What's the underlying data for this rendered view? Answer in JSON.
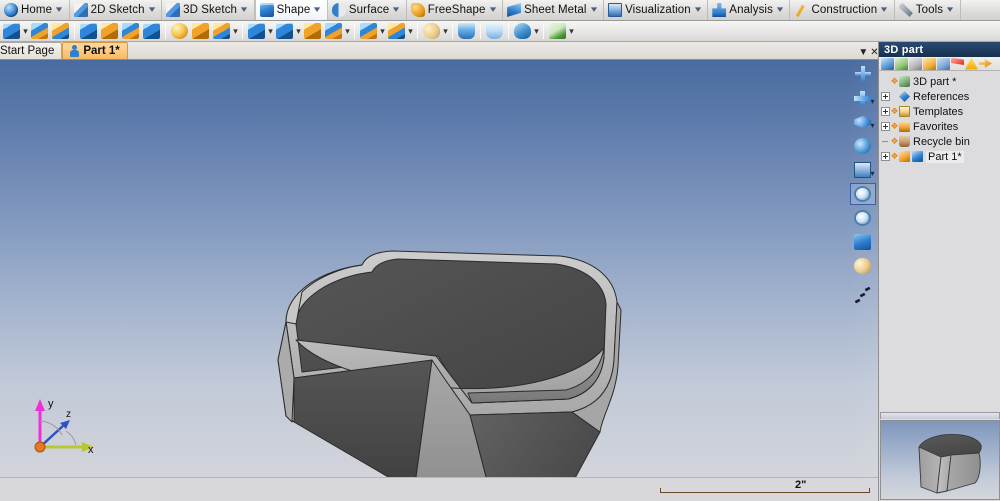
{
  "menubar": {
    "tabs": [
      {
        "label": "Home",
        "icon": "home-icon",
        "caret": true,
        "active": false
      },
      {
        "label": "2D Sketch",
        "icon": "pencil-icon",
        "caret": true,
        "active": false
      },
      {
        "label": "3D Sketch",
        "icon": "pencil-icon",
        "caret": true,
        "active": false
      },
      {
        "label": "Shape",
        "icon": "cube-icon",
        "caret": true,
        "active": true
      },
      {
        "label": "Surface",
        "icon": "surface-icon",
        "caret": true,
        "active": false
      },
      {
        "label": "FreeShape",
        "icon": "freeshape-icon",
        "caret": true,
        "active": false
      },
      {
        "label": "Sheet Metal",
        "icon": "sheetmetal-icon",
        "caret": true,
        "active": false
      },
      {
        "label": "Visualization",
        "icon": "monitor-icon",
        "caret": true,
        "active": false
      },
      {
        "label": "Analysis",
        "icon": "analysis-icon",
        "caret": true,
        "active": false
      },
      {
        "label": "Construction",
        "icon": "construction-icon",
        "caret": true,
        "active": false
      },
      {
        "label": "Tools",
        "icon": "wrench-icon",
        "caret": true,
        "active": false
      }
    ]
  },
  "toolbar": {
    "groups": [
      {
        "buttons": [
          {
            "icon": "extrude-icon",
            "style": "g-blue",
            "dropdown": true
          },
          {
            "icon": "revolve-icon",
            "style": "g-blueor",
            "dropdown": false
          },
          {
            "icon": "sweep-icon",
            "style": "g-orblue",
            "dropdown": false
          }
        ]
      },
      {
        "buttons": [
          {
            "icon": "box-icon",
            "style": "g-blue",
            "dropdown": false
          },
          {
            "icon": "cylinder-icon",
            "style": "g-orange",
            "dropdown": false
          },
          {
            "icon": "loft-icon",
            "style": "g-blueor",
            "dropdown": false
          },
          {
            "icon": "rib-icon",
            "style": "g-blue",
            "dropdown": false
          }
        ]
      },
      {
        "buttons": [
          {
            "icon": "sphere-icon",
            "style": "g-sphere",
            "dropdown": false
          },
          {
            "icon": "cube-solid-icon",
            "style": "g-orange",
            "dropdown": false
          },
          {
            "icon": "cone-icon",
            "style": "g-orblue",
            "dropdown": true
          }
        ]
      },
      {
        "buttons": [
          {
            "icon": "fillet-icon",
            "style": "g-blue",
            "dropdown": true
          },
          {
            "icon": "chamfer-icon",
            "style": "g-blue",
            "dropdown": true
          },
          {
            "icon": "draft-icon",
            "style": "g-orange",
            "dropdown": false
          },
          {
            "icon": "shell-icon",
            "style": "g-blueor",
            "dropdown": true
          }
        ]
      },
      {
        "buttons": [
          {
            "icon": "boolean-icon",
            "style": "g-blueor",
            "dropdown": true
          },
          {
            "icon": "thread-icon",
            "style": "g-orblue",
            "dropdown": true
          }
        ]
      },
      {
        "buttons": [
          {
            "icon": "material-icon",
            "style": "g-palette",
            "dropdown": true
          }
        ]
      },
      {
        "buttons": [
          {
            "icon": "trim-icon",
            "style": "g-cup",
            "dropdown": false
          }
        ]
      },
      {
        "buttons": [
          {
            "icon": "split-icon",
            "style": "g-cup2",
            "dropdown": false
          }
        ]
      },
      {
        "buttons": [
          {
            "icon": "measure-icon",
            "style": "g-mag",
            "dropdown": true
          }
        ]
      },
      {
        "buttons": [
          {
            "icon": "check-geometry-icon",
            "style": "g-green",
            "dropdown": true
          }
        ]
      }
    ]
  },
  "document_tabs": [
    {
      "label": "Start Page",
      "active": false,
      "icon": null
    },
    {
      "label": "Part 1*",
      "active": true,
      "icon": "part-icon"
    }
  ],
  "viewport_toolbar": {
    "buttons": [
      {
        "icon": "zoom-all-icon",
        "style": "c-plus",
        "dropdown": false,
        "selected": false
      },
      {
        "icon": "pan-icon",
        "style": "c-panh",
        "dropdown": true,
        "selected": false
      },
      {
        "icon": "rotate-icon",
        "style": "c-rot",
        "dropdown": true,
        "selected": false
      },
      {
        "icon": "orbit-icon",
        "style": "c-dot2",
        "dropdown": false,
        "selected": false
      },
      {
        "icon": "multi-view-icon",
        "style": "c-win",
        "dropdown": true,
        "selected": false
      },
      {
        "icon": "zoom-window-icon",
        "style": "c-zoomw",
        "dropdown": false,
        "selected": true
      },
      {
        "icon": "zoom-icon",
        "style": "c-zoomw",
        "dropdown": false,
        "selected": false
      },
      {
        "icon": "view-cube-icon",
        "style": "c-box",
        "dropdown": false,
        "selected": false
      },
      {
        "icon": "render-style-icon",
        "style": "c-pal",
        "dropdown": false,
        "selected": false
      }
    ]
  },
  "axis_triad": {
    "labels": {
      "x": "x",
      "y": "y",
      "z": "z"
    },
    "colors": {
      "x": "#b8c832",
      "y": "#ee30d8",
      "z": "#3050c8",
      "origin": "#e87820"
    }
  },
  "scale_bar": {
    "value": "2\""
  },
  "dock": {
    "title": "3D part",
    "controls": {
      "menu": "▼",
      "close": "✕"
    },
    "tool_icons": [
      {
        "name": "show-hide-icon",
        "style": "dt-a"
      },
      {
        "name": "tree-order-icon",
        "style": "dt-b"
      },
      {
        "name": "delete-node-icon",
        "style": "dt-c"
      },
      {
        "name": "rename-icon",
        "style": "dt-d"
      },
      {
        "name": "layers-icon",
        "style": "dt-e"
      },
      {
        "name": "flag-icon",
        "style": "dt-f"
      },
      {
        "name": "warning-icon",
        "style": "dt-g"
      },
      {
        "name": "collapse-icon",
        "style": "dt-h"
      }
    ],
    "tree": [
      {
        "label": "3D part *",
        "expander": "none",
        "marker": true,
        "icon": "ti-part",
        "indent": 0,
        "selected": false
      },
      {
        "label": "References",
        "expander": "plus",
        "marker": false,
        "icon": "ti-ref",
        "indent": 0,
        "selected": false
      },
      {
        "label": "Templates",
        "expander": "plus",
        "marker": true,
        "icon": "ti-tpl",
        "indent": 0,
        "selected": false
      },
      {
        "label": "Favorites",
        "expander": "plus",
        "marker": true,
        "icon": "ti-fav",
        "indent": 0,
        "selected": false
      },
      {
        "label": "Recycle bin",
        "expander": "dash",
        "marker": true,
        "icon": "ti-bin",
        "indent": 0,
        "selected": false
      },
      {
        "label": "Part 1*",
        "expander": "plus",
        "marker": true,
        "icon": "ti-p1a",
        "indent": 0,
        "selected": true
      }
    ]
  },
  "model": {
    "name": "shelled-rounded-box",
    "description": "Hollow shelled solid with rounded vertical edges and a stepped notch"
  },
  "colors": {
    "viewport_top": "#4a6ba0",
    "viewport_bottom": "#d2d4da",
    "model_light": "#b8b8b8",
    "model_mid": "#9a9a9a",
    "model_dark": "#4f4f4f",
    "dock_title_bg": "#1f3c62",
    "tab_active": "#ffc97e"
  }
}
